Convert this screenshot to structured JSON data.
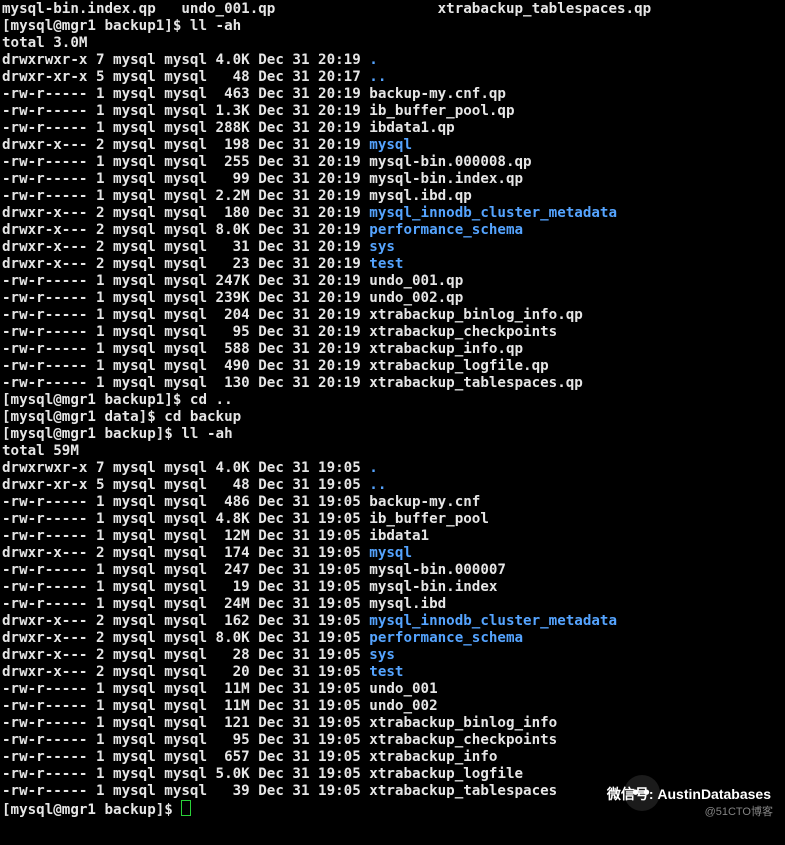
{
  "watermark": {
    "line1": "微信号: AustinDatabases",
    "line2": "@51CTO博客"
  },
  "rows": [
    {
      "text": "mysql-bin.index.qp   undo_001.qp                   xtrabackup_tablespaces.qp"
    },
    {
      "prompt": "[mysql@mgr1 backup1]$ ",
      "cmd": "ll -ah"
    },
    {
      "text": "total 3.0M"
    },
    {
      "perm": "drwxrwxr-x",
      "links": "7",
      "owner": "mysql",
      "group": "mysql",
      "size": "4.0K",
      "date": "Dec 31 20:19",
      "name": ".",
      "isdir": true
    },
    {
      "perm": "drwxr-xr-x",
      "links": "5",
      "owner": "mysql",
      "group": "mysql",
      "size": "48",
      "date": "Dec 31 20:17",
      "name": "..",
      "isdir": true
    },
    {
      "perm": "-rw-r-----",
      "links": "1",
      "owner": "mysql",
      "group": "mysql",
      "size": "463",
      "date": "Dec 31 20:19",
      "name": "backup-my.cnf.qp"
    },
    {
      "perm": "-rw-r-----",
      "links": "1",
      "owner": "mysql",
      "group": "mysql",
      "size": "1.3K",
      "date": "Dec 31 20:19",
      "name": "ib_buffer_pool.qp"
    },
    {
      "perm": "-rw-r-----",
      "links": "1",
      "owner": "mysql",
      "group": "mysql",
      "size": "288K",
      "date": "Dec 31 20:19",
      "name": "ibdata1.qp"
    },
    {
      "perm": "drwxr-x---",
      "links": "2",
      "owner": "mysql",
      "group": "mysql",
      "size": "198",
      "date": "Dec 31 20:19",
      "name": "mysql",
      "isdir": true
    },
    {
      "perm": "-rw-r-----",
      "links": "1",
      "owner": "mysql",
      "group": "mysql",
      "size": "255",
      "date": "Dec 31 20:19",
      "name": "mysql-bin.000008.qp"
    },
    {
      "perm": "-rw-r-----",
      "links": "1",
      "owner": "mysql",
      "group": "mysql",
      "size": "99",
      "date": "Dec 31 20:19",
      "name": "mysql-bin.index.qp"
    },
    {
      "perm": "-rw-r-----",
      "links": "1",
      "owner": "mysql",
      "group": "mysql",
      "size": "2.2M",
      "date": "Dec 31 20:19",
      "name": "mysql.ibd.qp"
    },
    {
      "perm": "drwxr-x---",
      "links": "2",
      "owner": "mysql",
      "group": "mysql",
      "size": "180",
      "date": "Dec 31 20:19",
      "name": "mysql_innodb_cluster_metadata",
      "isdir": true
    },
    {
      "perm": "drwxr-x---",
      "links": "2",
      "owner": "mysql",
      "group": "mysql",
      "size": "8.0K",
      "date": "Dec 31 20:19",
      "name": "performance_schema",
      "isdir": true
    },
    {
      "perm": "drwxr-x---",
      "links": "2",
      "owner": "mysql",
      "group": "mysql",
      "size": "31",
      "date": "Dec 31 20:19",
      "name": "sys",
      "isdir": true
    },
    {
      "perm": "drwxr-x---",
      "links": "2",
      "owner": "mysql",
      "group": "mysql",
      "size": "23",
      "date": "Dec 31 20:19",
      "name": "test",
      "isdir": true
    },
    {
      "perm": "-rw-r-----",
      "links": "1",
      "owner": "mysql",
      "group": "mysql",
      "size": "247K",
      "date": "Dec 31 20:19",
      "name": "undo_001.qp"
    },
    {
      "perm": "-rw-r-----",
      "links": "1",
      "owner": "mysql",
      "group": "mysql",
      "size": "239K",
      "date": "Dec 31 20:19",
      "name": "undo_002.qp"
    },
    {
      "perm": "-rw-r-----",
      "links": "1",
      "owner": "mysql",
      "group": "mysql",
      "size": "204",
      "date": "Dec 31 20:19",
      "name": "xtrabackup_binlog_info.qp"
    },
    {
      "perm": "-rw-r-----",
      "links": "1",
      "owner": "mysql",
      "group": "mysql",
      "size": "95",
      "date": "Dec 31 20:19",
      "name": "xtrabackup_checkpoints"
    },
    {
      "perm": "-rw-r-----",
      "links": "1",
      "owner": "mysql",
      "group": "mysql",
      "size": "588",
      "date": "Dec 31 20:19",
      "name": "xtrabackup_info.qp"
    },
    {
      "perm": "-rw-r-----",
      "links": "1",
      "owner": "mysql",
      "group": "mysql",
      "size": "490",
      "date": "Dec 31 20:19",
      "name": "xtrabackup_logfile.qp"
    },
    {
      "perm": "-rw-r-----",
      "links": "1",
      "owner": "mysql",
      "group": "mysql",
      "size": "130",
      "date": "Dec 31 20:19",
      "name": "xtrabackup_tablespaces.qp"
    },
    {
      "prompt": "[mysql@mgr1 backup1]$ ",
      "cmd": "cd .."
    },
    {
      "prompt": "[mysql@mgr1 data]$ ",
      "cmd": "cd backup"
    },
    {
      "prompt": "[mysql@mgr1 backup]$ ",
      "cmd": "ll -ah"
    },
    {
      "text": "total 59M"
    },
    {
      "perm": "drwxrwxr-x",
      "links": "7",
      "owner": "mysql",
      "group": "mysql",
      "size": "4.0K",
      "date": "Dec 31 19:05",
      "name": ".",
      "isdir": true
    },
    {
      "perm": "drwxr-xr-x",
      "links": "5",
      "owner": "mysql",
      "group": "mysql",
      "size": "48",
      "date": "Dec 31 19:05",
      "name": "..",
      "isdir": true
    },
    {
      "perm": "-rw-r-----",
      "links": "1",
      "owner": "mysql",
      "group": "mysql",
      "size": "486",
      "date": "Dec 31 19:05",
      "name": "backup-my.cnf"
    },
    {
      "perm": "-rw-r-----",
      "links": "1",
      "owner": "mysql",
      "group": "mysql",
      "size": "4.8K",
      "date": "Dec 31 19:05",
      "name": "ib_buffer_pool"
    },
    {
      "perm": "-rw-r-----",
      "links": "1",
      "owner": "mysql",
      "group": "mysql",
      "size": "12M",
      "date": "Dec 31 19:05",
      "name": "ibdata1"
    },
    {
      "perm": "drwxr-x---",
      "links": "2",
      "owner": "mysql",
      "group": "mysql",
      "size": "174",
      "date": "Dec 31 19:05",
      "name": "mysql",
      "isdir": true
    },
    {
      "perm": "-rw-r-----",
      "links": "1",
      "owner": "mysql",
      "group": "mysql",
      "size": "247",
      "date": "Dec 31 19:05",
      "name": "mysql-bin.000007"
    },
    {
      "perm": "-rw-r-----",
      "links": "1",
      "owner": "mysql",
      "group": "mysql",
      "size": "19",
      "date": "Dec 31 19:05",
      "name": "mysql-bin.index"
    },
    {
      "perm": "-rw-r-----",
      "links": "1",
      "owner": "mysql",
      "group": "mysql",
      "size": "24M",
      "date": "Dec 31 19:05",
      "name": "mysql.ibd"
    },
    {
      "perm": "drwxr-x---",
      "links": "2",
      "owner": "mysql",
      "group": "mysql",
      "size": "162",
      "date": "Dec 31 19:05",
      "name": "mysql_innodb_cluster_metadata",
      "isdir": true
    },
    {
      "perm": "drwxr-x---",
      "links": "2",
      "owner": "mysql",
      "group": "mysql",
      "size": "8.0K",
      "date": "Dec 31 19:05",
      "name": "performance_schema",
      "isdir": true
    },
    {
      "perm": "drwxr-x---",
      "links": "2",
      "owner": "mysql",
      "group": "mysql",
      "size": "28",
      "date": "Dec 31 19:05",
      "name": "sys",
      "isdir": true
    },
    {
      "perm": "drwxr-x---",
      "links": "2",
      "owner": "mysql",
      "group": "mysql",
      "size": "20",
      "date": "Dec 31 19:05",
      "name": "test",
      "isdir": true
    },
    {
      "perm": "-rw-r-----",
      "links": "1",
      "owner": "mysql",
      "group": "mysql",
      "size": "11M",
      "date": "Dec 31 19:05",
      "name": "undo_001"
    },
    {
      "perm": "-rw-r-----",
      "links": "1",
      "owner": "mysql",
      "group": "mysql",
      "size": "11M",
      "date": "Dec 31 19:05",
      "name": "undo_002"
    },
    {
      "perm": "-rw-r-----",
      "links": "1",
      "owner": "mysql",
      "group": "mysql",
      "size": "121",
      "date": "Dec 31 19:05",
      "name": "xtrabackup_binlog_info"
    },
    {
      "perm": "-rw-r-----",
      "links": "1",
      "owner": "mysql",
      "group": "mysql",
      "size": "95",
      "date": "Dec 31 19:05",
      "name": "xtrabackup_checkpoints"
    },
    {
      "perm": "-rw-r-----",
      "links": "1",
      "owner": "mysql",
      "group": "mysql",
      "size": "657",
      "date": "Dec 31 19:05",
      "name": "xtrabackup_info"
    },
    {
      "perm": "-rw-r-----",
      "links": "1",
      "owner": "mysql",
      "group": "mysql",
      "size": "5.0K",
      "date": "Dec 31 19:05",
      "name": "xtrabackup_logfile"
    },
    {
      "perm": "-rw-r-----",
      "links": "1",
      "owner": "mysql",
      "group": "mysql",
      "size": "39",
      "date": "Dec 31 19:05",
      "name": "xtrabackup_tablespaces"
    },
    {
      "prompt": "[mysql@mgr1 backup]$ ",
      "cursor": true
    }
  ]
}
